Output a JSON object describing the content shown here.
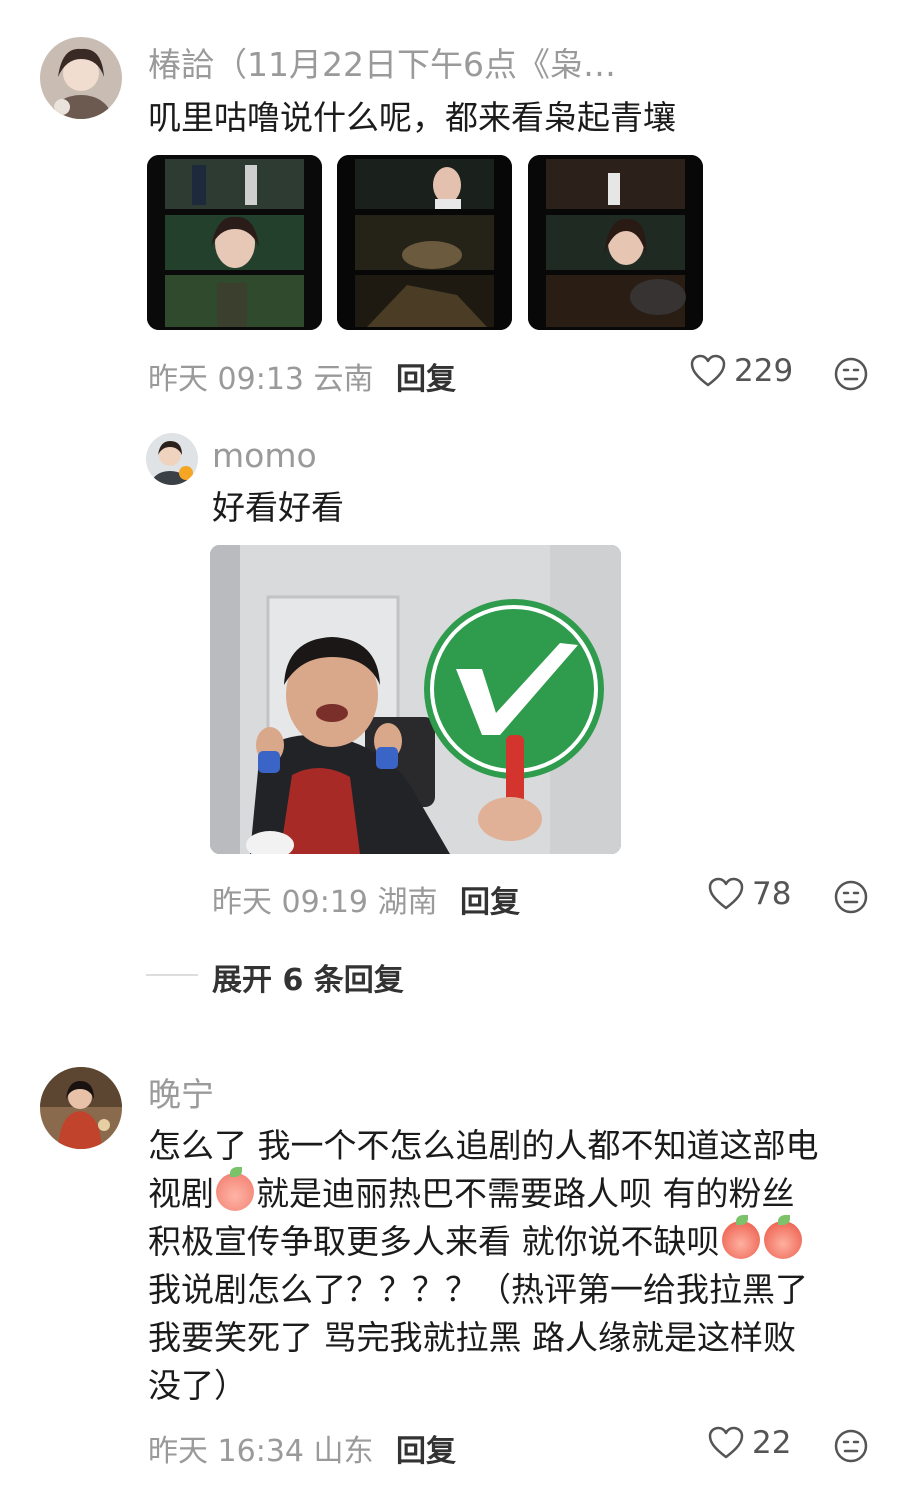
{
  "comments": [
    {
      "author": "椿詥（11月22日下午6点《枭…",
      "text": "叽里咕噜说什么呢，都来看枭起青壤",
      "meta": "昨天 09:13 云南",
      "reply_label": "回复",
      "likes": "229"
    },
    {
      "author": "momo",
      "text": "好看好看",
      "meta": "昨天 09:19 湖南",
      "reply_label": "回复",
      "likes": "78"
    },
    {
      "author": "晚宁",
      "text_lines": [
        "怎么了 我一个不怎么追剧的人都不知道这部电",
        "视剧",
        "就是迪丽热巴不需要路人呗 有的粉丝",
        "积极宣传争取更多人来看 就你说不缺呗",
        "我说剧怎么了？？？？（热评第一给我拉黑了",
        "我要笑死了 骂完我就拉黑 路人缘就是这样败",
        "没了）"
      ],
      "meta": "昨天 16:34 山东",
      "reply_label": "回复",
      "likes": "22"
    }
  ],
  "expand_label": "展开 6 条回复",
  "icons": {
    "like": "heart-outline-icon",
    "emoji": "emoji-face-icon"
  },
  "colors": {
    "meta_gray": "#9a9a9a",
    "check_green": "#2f9b4c"
  }
}
